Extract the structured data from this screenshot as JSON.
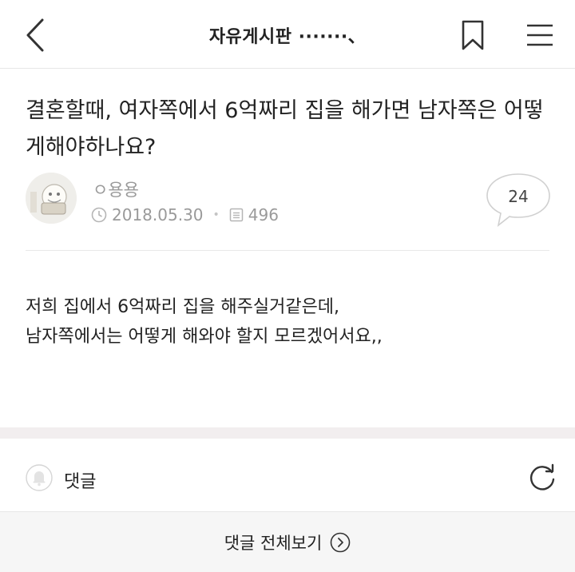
{
  "header": {
    "title": "자유게시판 ·······、",
    "back_icon": "chevron-left-icon",
    "bookmark_icon": "bookmark-icon",
    "menu_icon": "hamburger-menu-icon"
  },
  "post": {
    "title": "결혼할때, 여자쪽에서 6억짜리 집을 해가면 남자쪽은 어떻게해야하나요?",
    "author": "ㅇ용용",
    "date": "2018.05.30",
    "views": "496",
    "comment_count": "24",
    "body_lines": [
      "저희 집에서 6억짜리 집을 해주실거같은데,",
      "남자쪽에서는 어떻게 해와야 할지 모르겠어서요,,"
    ]
  },
  "comments": {
    "label": "댓글",
    "view_all_label": "댓글 전체보기"
  },
  "colors": {
    "text": "#222222",
    "meta": "#9a9a9a",
    "gap_bar": "#f2eeef",
    "footer_bg": "#f6f6f6"
  }
}
